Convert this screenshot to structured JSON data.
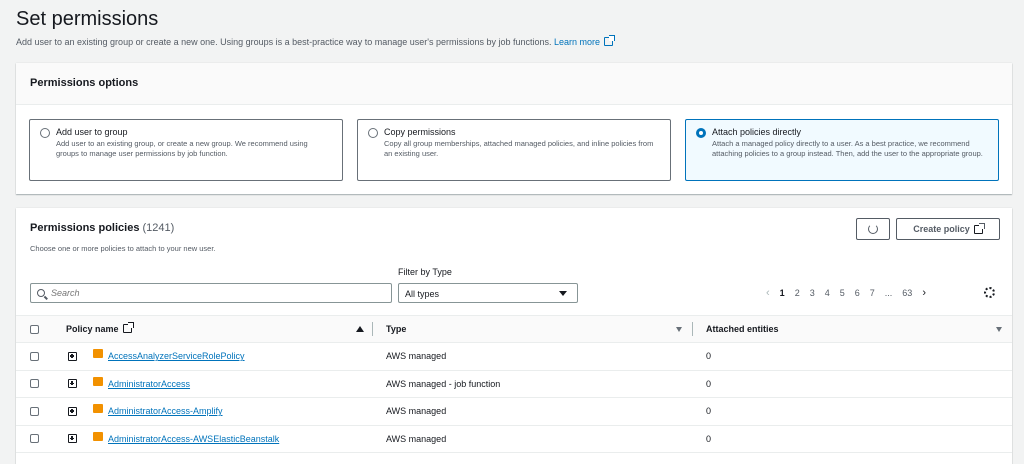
{
  "header": {
    "title": "Set permissions",
    "description": "Add user to an existing group or create a new one. Using groups is a best-practice way to manage user's permissions by job functions.",
    "learn_more": "Learn more"
  },
  "options": {
    "title": "Permissions options",
    "tiles": [
      {
        "title": "Add user to group",
        "desc": "Add user to an existing group, or create a new group. We recommend using groups to manage user permissions by job function.",
        "selected": false
      },
      {
        "title": "Copy permissions",
        "desc": "Copy all group memberships, attached managed policies, and inline policies from an existing user.",
        "selected": false
      },
      {
        "title": "Attach policies directly",
        "desc": "Attach a managed policy directly to a user. As a best practice, we recommend attaching policies to a group instead. Then, add the user to the appropriate group.",
        "selected": true
      }
    ]
  },
  "policies": {
    "title": "Permissions policies",
    "count": "(1241)",
    "description": "Choose one or more policies to attach to your new user.",
    "refresh_icon": "refresh-icon",
    "create_label": "Create policy",
    "filter_label": "Filter by Type",
    "search_placeholder": "Search",
    "filter_value": "All types",
    "pagination": {
      "prev": "‹",
      "pages": [
        "1",
        "2",
        "3",
        "4",
        "5",
        "6",
        "7"
      ],
      "ellipsis": "...",
      "last": "63",
      "next": "›",
      "current": "1"
    },
    "columns": {
      "name": "Policy name",
      "type": "Type",
      "attached": "Attached entities"
    },
    "rows": [
      {
        "name": "AccessAnalyzerServiceRolePolicy",
        "type": "AWS managed",
        "attached": "0"
      },
      {
        "name": "AdministratorAccess",
        "type": "AWS managed - job function",
        "attached": "0"
      },
      {
        "name": "AdministratorAccess-Amplify",
        "type": "AWS managed",
        "attached": "0"
      },
      {
        "name": "AdministratorAccess-AWSElasticBeanstalk",
        "type": "AWS managed",
        "attached": "0"
      }
    ]
  },
  "colors": {
    "accent": "#0073bb",
    "policy_icon": "#f29100"
  }
}
